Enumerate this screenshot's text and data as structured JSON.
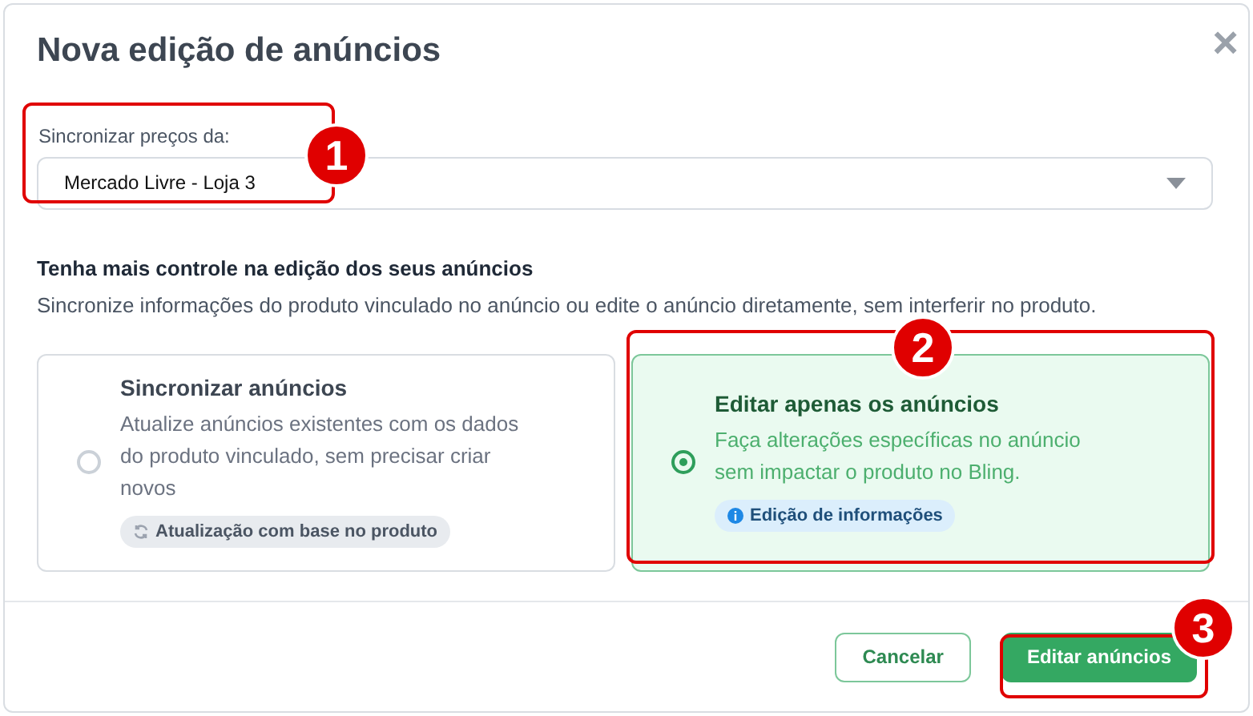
{
  "dialog": {
    "title": "Nova edição de anúncios",
    "close_label": "×"
  },
  "price_sync": {
    "label": "Sincronizar preços da:",
    "value": "Mercado Livre - Loja 3"
  },
  "section": {
    "heading": "Tenha mais controle na edição dos seus anúncios",
    "description": "Sincronize informações do produto vinculado no anúncio ou edite o anúncio diretamente, sem interferir no produto."
  },
  "options": [
    {
      "title": "Sincronizar anúncios",
      "description": "Atualize anúncios existentes com os dados do produto vinculado, sem precisar criar novos",
      "tag": "Atualização com base no produto",
      "kind": "sync",
      "selected": false
    },
    {
      "title": "Editar apenas os anúncios",
      "description": "Faça alterações específicas no anúncio sem impactar o produto no Bling.",
      "tag": "Edição de informações",
      "kind": "info",
      "selected": true
    }
  ],
  "buttons": [
    {
      "label": "Cancelar",
      "kind": "secondary"
    },
    {
      "label": "Editar anúncios",
      "kind": "primary"
    }
  ],
  "annotations": [
    "1",
    "2",
    "3"
  ]
}
